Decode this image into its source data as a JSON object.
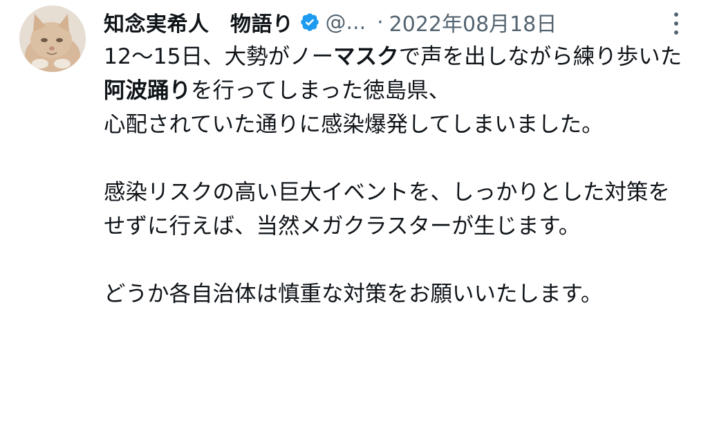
{
  "tweet": {
    "author": {
      "display_name": "知念実希人　物語り",
      "handle": "@...",
      "verified": true,
      "avatar": "cat-avatar"
    },
    "separator": "·",
    "timestamp": "2022年08月18日",
    "more_icon": "more-vertical-icon",
    "paragraph1": {
      "segments": [
        {
          "text": "12〜15日、大勢がノー",
          "bold": false
        },
        {
          "text": "マスク",
          "bold": true
        },
        {
          "text": "で声を出しながら練り歩いた",
          "bold": false
        },
        {
          "text": "阿波踊り",
          "bold": true
        },
        {
          "text": "を行ってしまった徳島県、",
          "bold": false
        }
      ],
      "line2": "心配されていた通りに感染爆発してしまいました。"
    },
    "paragraph2": "感染リスクの高い巨大イベントを、しっかりとした対策をせずに行えば、当然メガクラスターが生じます。",
    "paragraph3": "どうか各自治体は慎重な対策をお願いいたします。",
    "colors": {
      "text": "#0f1419",
      "secondary": "#536471",
      "verified": "#1d9bf0"
    }
  }
}
